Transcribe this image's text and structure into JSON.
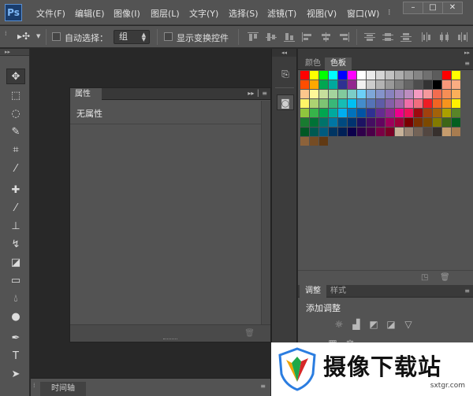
{
  "app": {
    "logo": "Ps"
  },
  "menu": [
    {
      "label": "文件(F)"
    },
    {
      "label": "编辑(E)"
    },
    {
      "label": "图像(I)"
    },
    {
      "label": "图层(L)"
    },
    {
      "label": "文字(Y)"
    },
    {
      "label": "选择(S)"
    },
    {
      "label": "滤镜(T)"
    },
    {
      "label": "视图(V)"
    },
    {
      "label": "窗口(W)"
    }
  ],
  "window_controls": {
    "minimize": "–",
    "restore": "□",
    "close": "✕"
  },
  "options_bar": {
    "auto_select_label": "自动选择：",
    "auto_select_value": "组",
    "show_transform_label": "显示变换控件"
  },
  "properties_panel": {
    "tab": "属性",
    "empty_text": "无属性"
  },
  "timeline": {
    "tab": "时间轴"
  },
  "color_panel": {
    "tabs": [
      {
        "label": "颜色"
      },
      {
        "label": "色板"
      }
    ],
    "active_tab": "色板",
    "swatches": [
      "#ff0000",
      "#ffff00",
      "#00ff00",
      "#00ffff",
      "#0000ff",
      "#ff00ff",
      "#ffffff",
      "#ebebeb",
      "#d6d6d6",
      "#c2c2c2",
      "#adadad",
      "#999999",
      "#858585",
      "#707070",
      "#5c5c5c",
      "#ff0000",
      "#ffff00",
      "#ff4d00",
      "#ffa800",
      "#00a651",
      "#00a99d",
      "#2e3192",
      "#92278f",
      "#f1f1f1",
      "#cccccc",
      "#b3b3b3",
      "#999999",
      "#808080",
      "#666666",
      "#4d4d4d",
      "#333333",
      "#000000",
      "#f7977a",
      "#fbad82",
      "#fdc68c",
      "#fff799",
      "#c6df9c",
      "#a4d49d",
      "#81ca9d",
      "#7bcdc8",
      "#6ccff7",
      "#7ea7d8",
      "#8493ca",
      "#8882be",
      "#a286bd",
      "#bc8dbf",
      "#f49bc1",
      "#f5999d",
      "#f26c4f",
      "#f68e55",
      "#fbaf5a",
      "#fff467",
      "#acd372",
      "#7dc473",
      "#39b778",
      "#16bcb4",
      "#00bff3",
      "#438ccb",
      "#5573b7",
      "#5e5ca7",
      "#855fa8",
      "#a763a9",
      "#ef6ea8",
      "#f16d7e",
      "#ee1d24",
      "#f16522",
      "#f7941d",
      "#fff100",
      "#8fc63d",
      "#37b44a",
      "#00a650",
      "#00a99e",
      "#00aeef",
      "#0072bc",
      "#0054a5",
      "#2f3192",
      "#652c91",
      "#91278f",
      "#ed008c",
      "#ee105a",
      "#9d0a0e",
      "#a1410d",
      "#a36209",
      "#aba000",
      "#588528",
      "#197b30",
      "#007236",
      "#00736a",
      "#0076a4",
      "#004a80",
      "#003370",
      "#1d1363",
      "#450e61",
      "#62055f",
      "#9e005c",
      "#9d0039",
      "#790000",
      "#7b3000",
      "#7c4900",
      "#827a00",
      "#3e6617",
      "#045f20",
      "#005824",
      "#005951",
      "#005b7e",
      "#003562",
      "#002056",
      "#0c004b",
      "#30004a",
      "#4b0048",
      "#7a0045",
      "#7a0026",
      "#c7b299",
      "#998675",
      "#736357",
      "#534741",
      "#37302d",
      "#c69c6d",
      "#a77c50",
      "#8c623a",
      "#754c24",
      "#603913"
    ]
  },
  "adjustments_panel": {
    "tabs": [
      {
        "label": "调整"
      },
      {
        "label": "样式"
      }
    ],
    "title": "添加调整"
  },
  "watermark": {
    "text": "摄像下载站",
    "url": "sxtgr.com"
  }
}
